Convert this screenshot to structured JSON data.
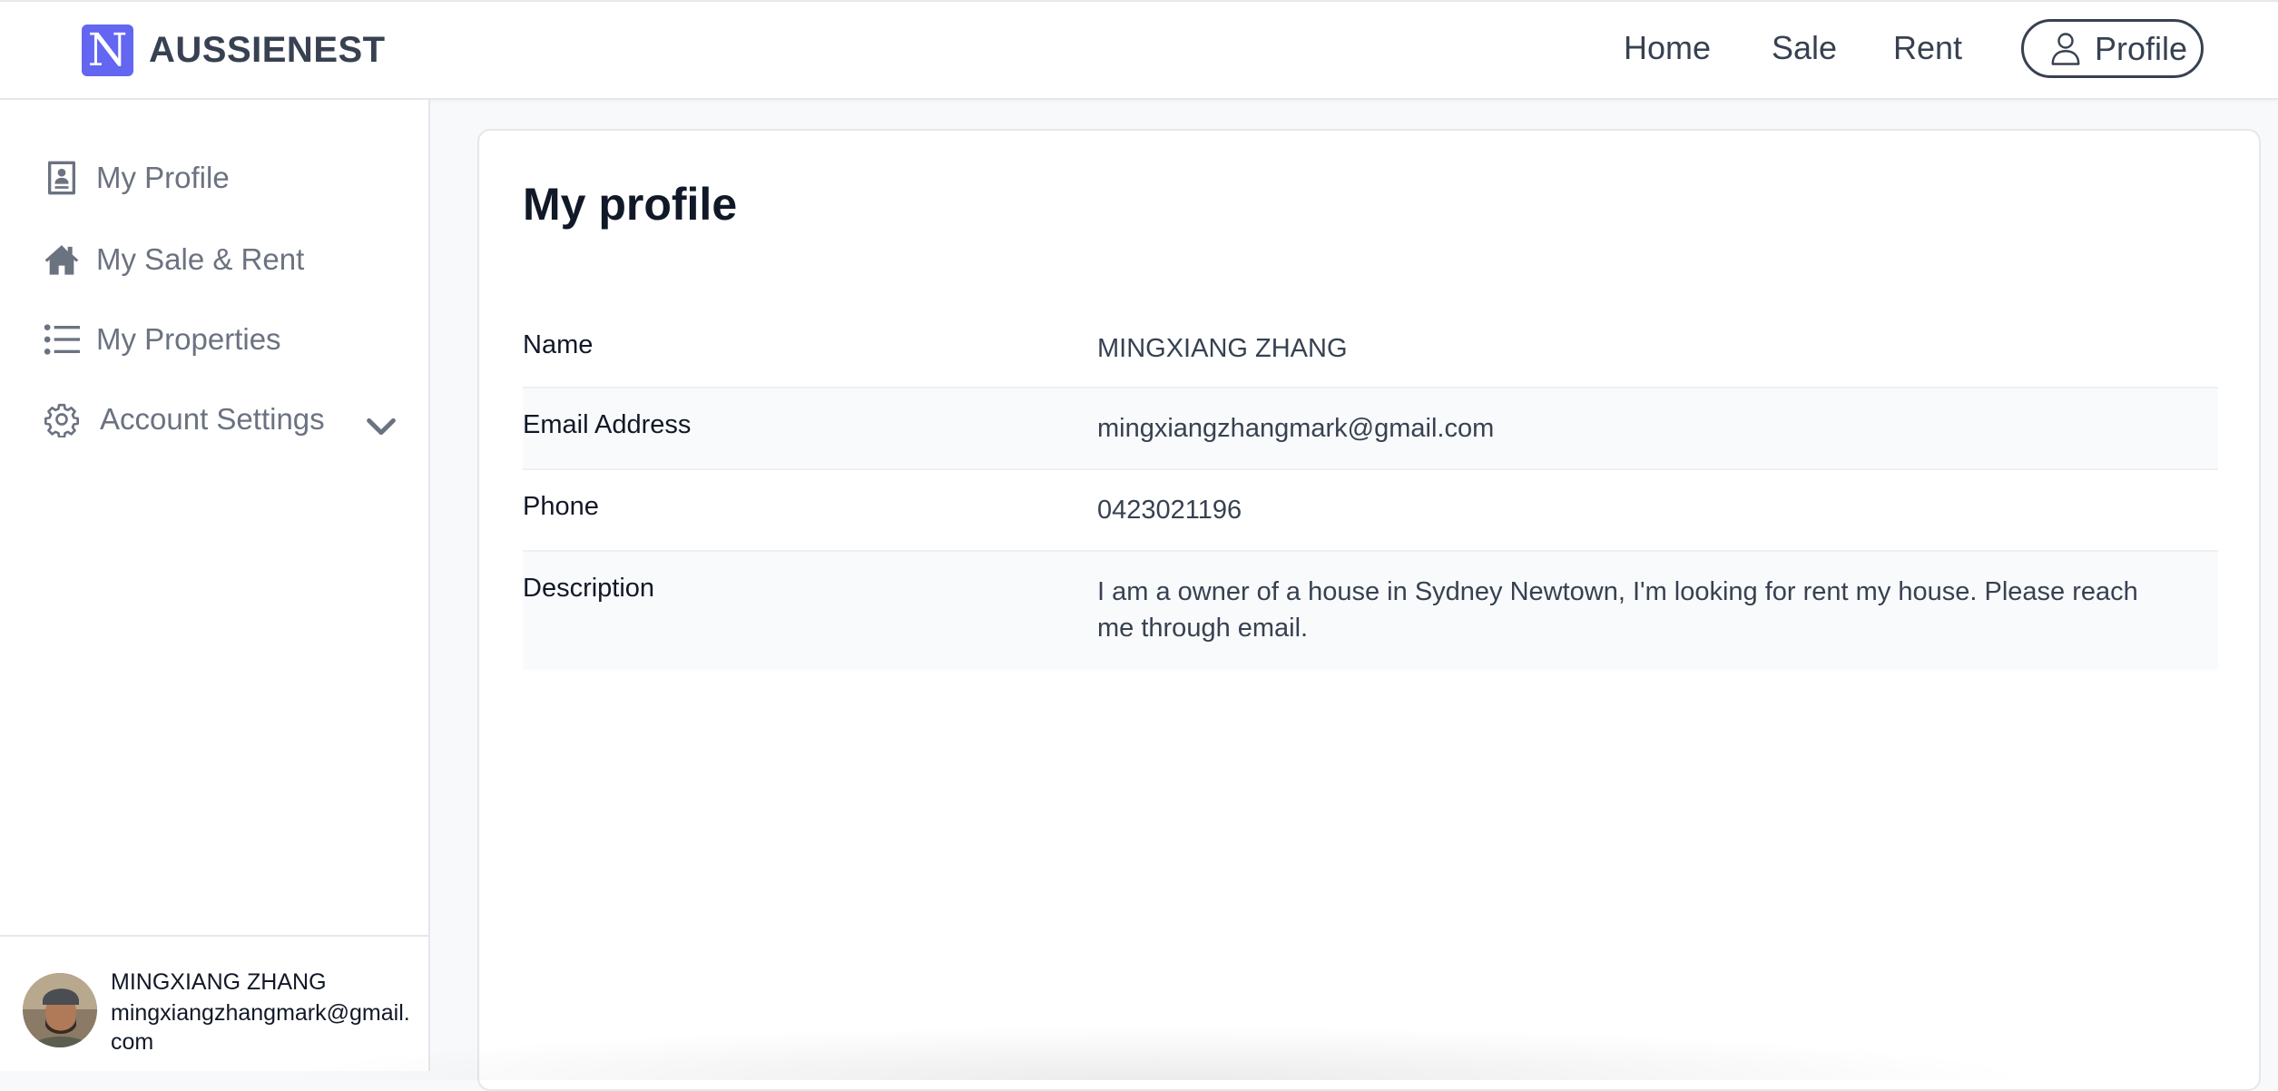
{
  "header": {
    "brand_letter": "N",
    "brand_name": "AUSSIENEST",
    "nav": {
      "home": "Home",
      "sale": "Sale",
      "rent": "Rent",
      "profile": "Profile"
    }
  },
  "sidebar": {
    "items": [
      {
        "label": "My Profile",
        "icon": "id-card-icon"
      },
      {
        "label": "My Sale & Rent",
        "icon": "house-icon"
      },
      {
        "label": "My Properties",
        "icon": "list-icon"
      },
      {
        "label": "Account Settings",
        "icon": "gear-icon"
      }
    ],
    "user": {
      "name": "MINGXIANG ZHANG",
      "email": "mingxiangzhangmark@gmail.com"
    }
  },
  "main": {
    "title": "My profile",
    "fields": [
      {
        "key": "Name",
        "value": "MINGXIANG ZHANG"
      },
      {
        "key": "Email Address",
        "value": "mingxiangzhangmark@gmail.com"
      },
      {
        "key": "Phone",
        "value": "0423021196"
      },
      {
        "key": "Description",
        "value": "I am a owner of a house in Sydney Newtown, I'm looking for rent my house. Please reach me through email."
      }
    ]
  },
  "colors": {
    "accent": "#6366f1",
    "text": "#374151",
    "muted": "#6b7280"
  }
}
